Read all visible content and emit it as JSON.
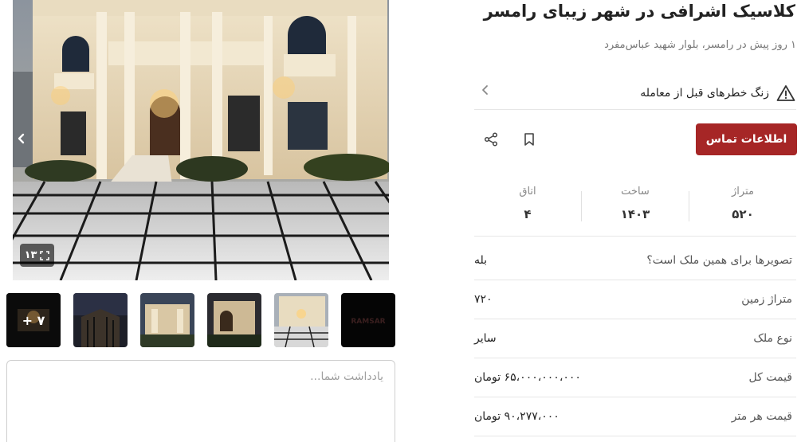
{
  "gallery": {
    "photo_count": "۱۳",
    "more_thumbnails": "+ ۷",
    "thumbnail_watermark": "RAMSAR",
    "note_placeholder": "یادداشت شما..."
  },
  "listing": {
    "title": "کلاسیک اشرافی در شهر زیبای رامسر",
    "subtitle": "۱ روز پیش در رامسر، بلوار شهید عباس‌مفرد",
    "risk_warning": "زنگ خطرهای قبل از معامله",
    "contact_button": "اطلاعات تماس"
  },
  "stats": [
    {
      "label": "متراژ",
      "value": "۵۲۰"
    },
    {
      "label": "ساخت",
      "value": "۱۴۰۳"
    },
    {
      "label": "اتاق",
      "value": "۴"
    }
  ],
  "details": [
    {
      "key": "تصویرها برای همین ملک است؟",
      "value": "بله"
    },
    {
      "key": "متراژ زمین",
      "value": "۷۲۰"
    },
    {
      "key": "نوع ملک",
      "value": "سایر"
    },
    {
      "key": "قیمت کل",
      "value": "۶۵،۰۰۰،۰۰۰،۰۰۰ تومان"
    },
    {
      "key": "قیمت هر متر",
      "value": "۹۰،۲۷۷،۰۰۰ تومان"
    }
  ],
  "icons": {
    "prev": "chevron-left-icon",
    "next": "chevron-right-icon",
    "expand": "expand-icon",
    "warning": "warning-triangle-icon",
    "chevron": "chevron-left-icon",
    "bookmark": "bookmark-icon",
    "share": "share-icon"
  },
  "colors": {
    "primary": "#a62626",
    "text": "#222222",
    "muted": "#777777",
    "divider": "#e6e6e6"
  }
}
